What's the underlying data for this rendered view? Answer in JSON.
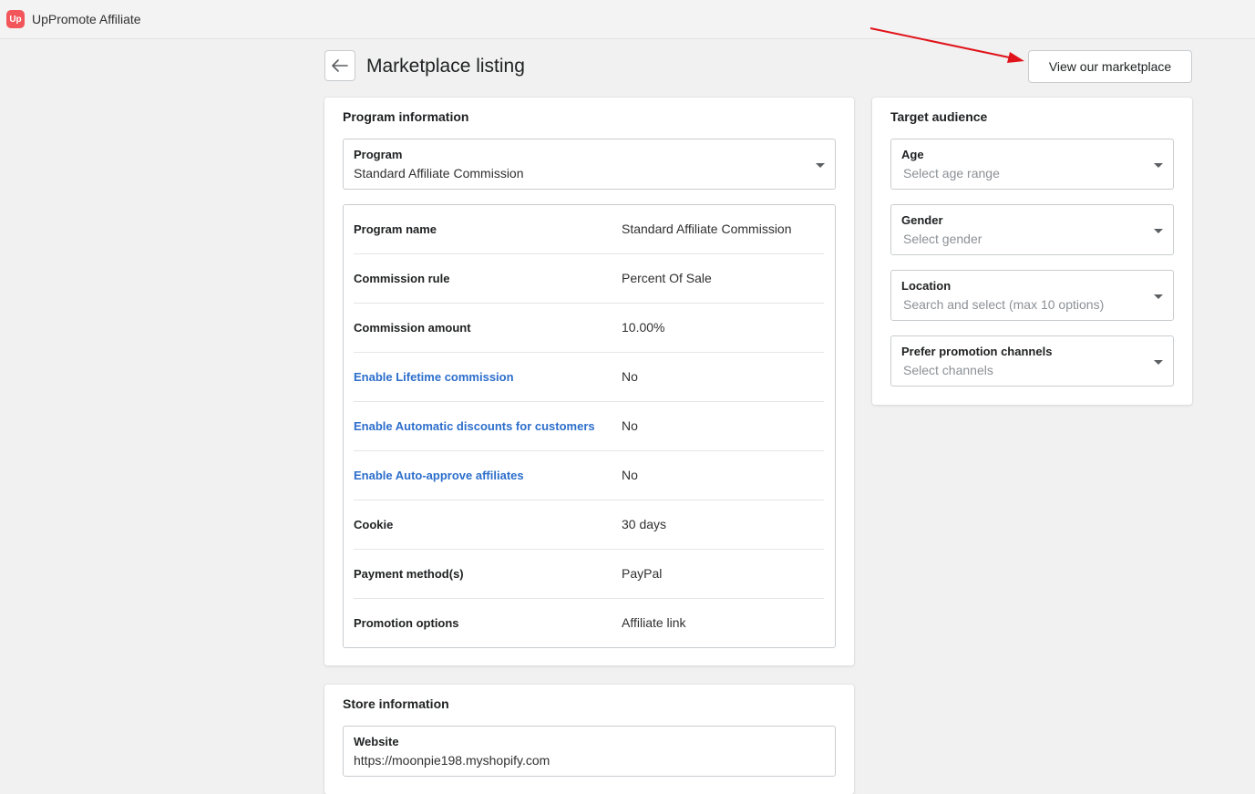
{
  "app": {
    "title": "UpPromote Affiliate",
    "logo_text": "Up"
  },
  "header": {
    "page_title": "Marketplace listing",
    "view_marketplace_label": "View our marketplace"
  },
  "program_information": {
    "title": "Program information",
    "program_select": {
      "label": "Program",
      "value": "Standard Affiliate Commission"
    },
    "details": [
      {
        "key": "Program name",
        "value": "Standard Affiliate Commission",
        "link": false
      },
      {
        "key": "Commission rule",
        "value": "Percent Of Sale",
        "link": false
      },
      {
        "key": "Commission amount",
        "value": "10.00%",
        "link": false
      },
      {
        "key": "Enable Lifetime commission",
        "value": "No",
        "link": true
      },
      {
        "key": "Enable Automatic discounts for customers",
        "value": "No",
        "link": true
      },
      {
        "key": "Enable Auto-approve affiliates",
        "value": "No",
        "link": true
      },
      {
        "key": "Cookie",
        "value": "30 days",
        "link": false
      },
      {
        "key": "Payment method(s)",
        "value": "PayPal",
        "link": false
      },
      {
        "key": "Promotion options",
        "value": "Affiliate link",
        "link": false
      }
    ]
  },
  "store_information": {
    "title": "Store information",
    "website": {
      "label": "Website",
      "value": "https://moonpie198.myshopify.com"
    }
  },
  "target_audience": {
    "title": "Target audience",
    "fields": [
      {
        "label": "Age",
        "placeholder": "Select age range"
      },
      {
        "label": "Gender",
        "placeholder": "Select gender"
      },
      {
        "label": "Location",
        "placeholder": "Search and select (max 10 options)"
      },
      {
        "label": "Prefer promotion channels",
        "placeholder": "Select channels"
      }
    ]
  },
  "colors": {
    "accent": "#2c6ecb",
    "logo": "#f2555a",
    "annotation_arrow": "#e0131a"
  }
}
